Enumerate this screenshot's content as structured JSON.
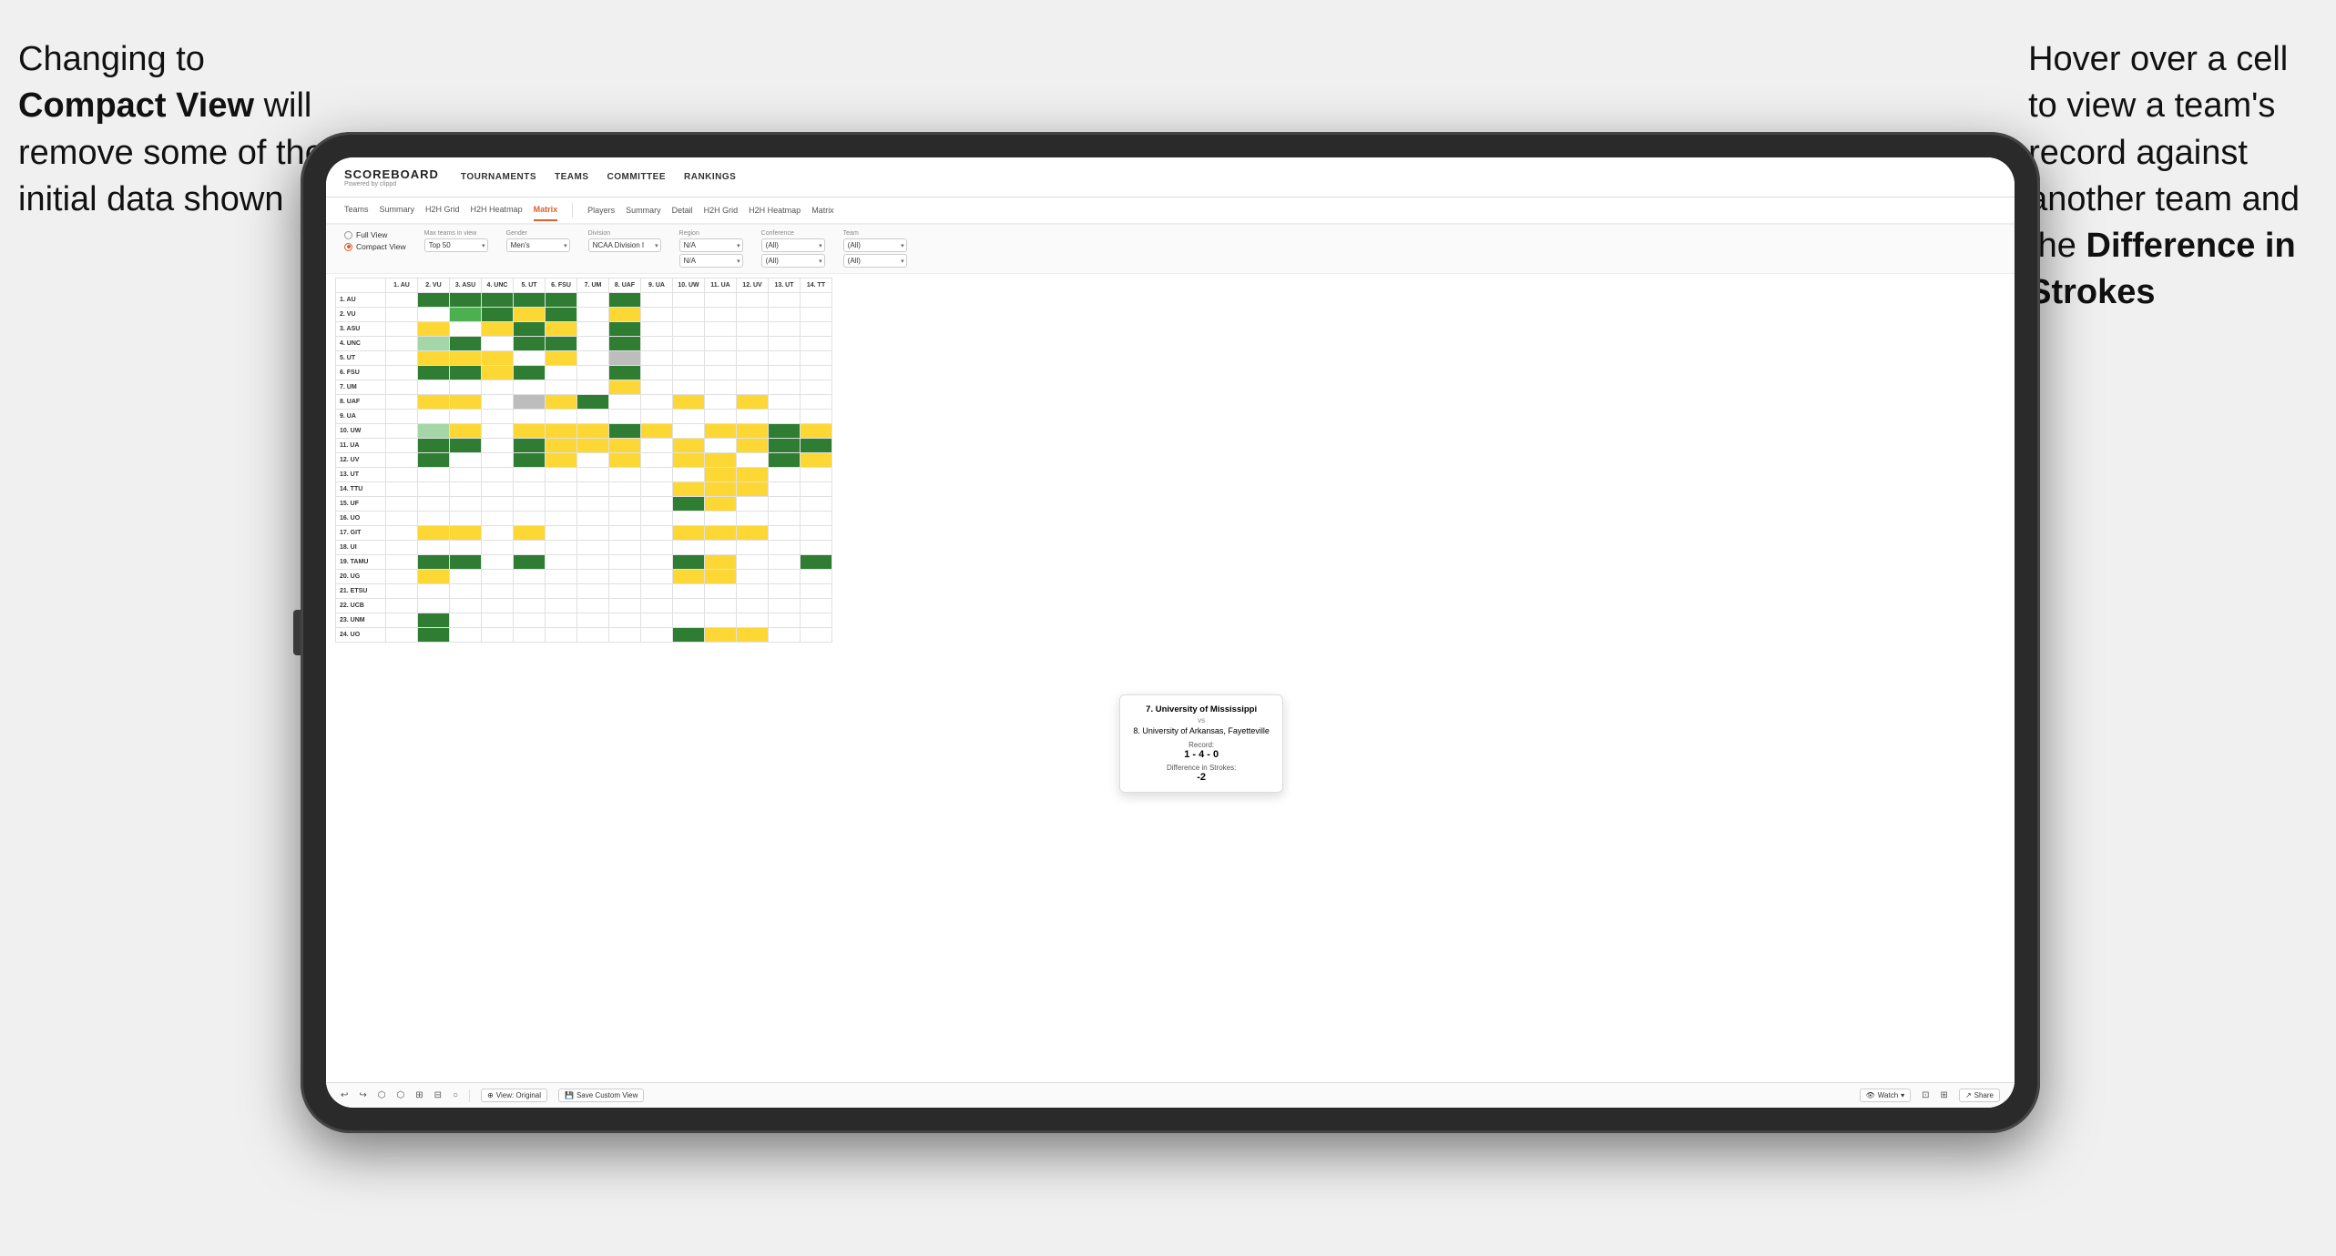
{
  "annotations": {
    "left": {
      "line1": "Changing to",
      "line2_bold": "Compact View",
      "line2_rest": " will",
      "line3": "remove some of the",
      "line4": "initial data shown"
    },
    "right": {
      "line1": "Hover over a cell",
      "line2": "to view a team's",
      "line3": "record against",
      "line4": "another team and",
      "line5_pre": "the ",
      "line5_bold": "Difference in",
      "line6_bold": "Strokes"
    }
  },
  "nav": {
    "logo": "SCOREBOARD",
    "logo_sub": "Powered by clippd",
    "links": [
      "TOURNAMENTS",
      "TEAMS",
      "COMMITTEE",
      "RANKINGS"
    ]
  },
  "sub_nav": {
    "group1": [
      "Teams",
      "Summary",
      "H2H Grid",
      "H2H Heatmap",
      "Matrix"
    ],
    "group2": [
      "Players",
      "Summary",
      "Detail",
      "H2H Grid",
      "H2H Heatmap",
      "Matrix"
    ],
    "active": "Matrix"
  },
  "controls": {
    "view_options": [
      "Full View",
      "Compact View"
    ],
    "view_selected": "Compact View",
    "max_teams_label": "Max teams in view",
    "max_teams_value": "Top 50",
    "gender_label": "Gender",
    "gender_value": "Men's",
    "division_label": "Division",
    "division_value": "NCAA Division I",
    "region_label": "Region",
    "region_value1": "N/A",
    "region_value2": "N/A",
    "conference_label": "Conference",
    "conference_value1": "(All)",
    "conference_value2": "(All)",
    "team_label": "Team",
    "team_value1": "(All)",
    "team_value2": "(All)"
  },
  "matrix": {
    "col_headers": [
      "",
      "1. AU",
      "2. VU",
      "3. ASU",
      "4. UNC",
      "5. UT",
      "6. FSU",
      "7. UM",
      "8. UAF",
      "9. UA",
      "10. UW",
      "11. UA",
      "12. UV",
      "13. UT",
      "14. TT"
    ],
    "rows": [
      {
        "label": "1. AU",
        "cells": [
          "diag",
          "green_dark",
          "green_dark",
          "green_dark",
          "green_dark",
          "green_dark",
          "white",
          "green_dark",
          "white",
          "white",
          "white",
          "white",
          "white",
          "white"
        ]
      },
      {
        "label": "2. VU",
        "cells": [
          "white",
          "diag",
          "green_med",
          "green_dark",
          "yellow",
          "green_dark",
          "white",
          "yellow",
          "white",
          "white",
          "white",
          "white",
          "white",
          "white"
        ]
      },
      {
        "label": "3. ASU",
        "cells": [
          "white",
          "yellow",
          "diag",
          "yellow",
          "green_dark",
          "yellow",
          "white",
          "green_dark",
          "white",
          "white",
          "white",
          "white",
          "white",
          "white"
        ]
      },
      {
        "label": "4. UNC",
        "cells": [
          "white",
          "green_light",
          "green_dark",
          "diag",
          "green_dark",
          "green_dark",
          "white",
          "green_dark",
          "white",
          "white",
          "white",
          "white",
          "white",
          "white"
        ]
      },
      {
        "label": "5. UT",
        "cells": [
          "white",
          "yellow",
          "yellow",
          "yellow",
          "diag",
          "yellow",
          "white",
          "gray",
          "white",
          "white",
          "white",
          "white",
          "white",
          "white"
        ]
      },
      {
        "label": "6. FSU",
        "cells": [
          "white",
          "green_dark",
          "green_dark",
          "yellow",
          "green_dark",
          "diag",
          "white",
          "green_dark",
          "white",
          "white",
          "white",
          "white",
          "white",
          "white"
        ]
      },
      {
        "label": "7. UM",
        "cells": [
          "white",
          "white",
          "white",
          "white",
          "white",
          "white",
          "diag",
          "yellow",
          "white",
          "white",
          "white",
          "white",
          "white",
          "white"
        ]
      },
      {
        "label": "8. UAF",
        "cells": [
          "white",
          "yellow",
          "yellow",
          "white",
          "gray",
          "yellow",
          "green_dark",
          "diag",
          "white",
          "yellow",
          "white",
          "yellow",
          "white",
          "white"
        ]
      },
      {
        "label": "9. UA",
        "cells": [
          "white",
          "white",
          "white",
          "white",
          "white",
          "white",
          "white",
          "white",
          "diag",
          "white",
          "white",
          "white",
          "white",
          "white"
        ]
      },
      {
        "label": "10. UW",
        "cells": [
          "white",
          "green_light",
          "yellow",
          "white",
          "yellow",
          "yellow",
          "yellow",
          "green_dark",
          "yellow",
          "diag",
          "yellow",
          "yellow",
          "green_dark",
          "yellow"
        ]
      },
      {
        "label": "11. UA",
        "cells": [
          "white",
          "green_dark",
          "green_dark",
          "white",
          "green_dark",
          "yellow",
          "yellow",
          "yellow",
          "white",
          "yellow",
          "diag",
          "yellow",
          "green_dark",
          "green_dark"
        ]
      },
      {
        "label": "12. UV",
        "cells": [
          "white",
          "green_dark",
          "white",
          "white",
          "green_dark",
          "yellow",
          "white",
          "yellow",
          "white",
          "yellow",
          "yellow",
          "diag",
          "green_dark",
          "yellow"
        ]
      },
      {
        "label": "13. UT",
        "cells": [
          "white",
          "white",
          "white",
          "white",
          "white",
          "white",
          "white",
          "white",
          "white",
          "white",
          "yellow",
          "yellow",
          "diag",
          "white"
        ]
      },
      {
        "label": "14. TTU",
        "cells": [
          "white",
          "white",
          "white",
          "white",
          "white",
          "white",
          "white",
          "white",
          "white",
          "yellow",
          "yellow",
          "yellow",
          "white",
          "diag"
        ]
      },
      {
        "label": "15. UF",
        "cells": [
          "white",
          "white",
          "white",
          "white",
          "white",
          "white",
          "white",
          "white",
          "white",
          "green_dark",
          "yellow",
          "white",
          "white",
          "white"
        ]
      },
      {
        "label": "16. UO",
        "cells": [
          "white",
          "white",
          "white",
          "white",
          "white",
          "white",
          "white",
          "white",
          "white",
          "white",
          "white",
          "white",
          "white",
          "white"
        ]
      },
      {
        "label": "17. GIT",
        "cells": [
          "white",
          "yellow",
          "yellow",
          "white",
          "yellow",
          "white",
          "white",
          "white",
          "white",
          "yellow",
          "yellow",
          "yellow",
          "white",
          "white"
        ]
      },
      {
        "label": "18. UI",
        "cells": [
          "white",
          "white",
          "white",
          "white",
          "white",
          "white",
          "white",
          "white",
          "white",
          "white",
          "white",
          "white",
          "white",
          "white"
        ]
      },
      {
        "label": "19. TAMU",
        "cells": [
          "white",
          "green_dark",
          "green_dark",
          "white",
          "green_dark",
          "white",
          "white",
          "white",
          "white",
          "green_dark",
          "yellow",
          "white",
          "white",
          "green_dark"
        ]
      },
      {
        "label": "20. UG",
        "cells": [
          "white",
          "yellow",
          "white",
          "white",
          "white",
          "white",
          "white",
          "white",
          "white",
          "yellow",
          "yellow",
          "white",
          "white",
          "white"
        ]
      },
      {
        "label": "21. ETSU",
        "cells": [
          "white",
          "white",
          "white",
          "white",
          "white",
          "white",
          "white",
          "white",
          "white",
          "white",
          "white",
          "white",
          "white",
          "white"
        ]
      },
      {
        "label": "22. UCB",
        "cells": [
          "white",
          "white",
          "white",
          "white",
          "white",
          "white",
          "white",
          "white",
          "white",
          "white",
          "white",
          "white",
          "white",
          "white"
        ]
      },
      {
        "label": "23. UNM",
        "cells": [
          "white",
          "green_dark",
          "white",
          "white",
          "white",
          "white",
          "white",
          "white",
          "white",
          "white",
          "white",
          "white",
          "white",
          "white"
        ]
      },
      {
        "label": "24. UO",
        "cells": [
          "white",
          "green_dark",
          "white",
          "white",
          "white",
          "white",
          "white",
          "white",
          "white",
          "green_dark",
          "yellow",
          "yellow",
          "white",
          "white"
        ]
      }
    ]
  },
  "tooltip": {
    "team1": "7. University of Mississippi",
    "vs": "vs",
    "team2": "8. University of Arkansas, Fayetteville",
    "record_label": "Record:",
    "record_value": "1 - 4 - 0",
    "strokes_label": "Difference in Strokes:",
    "strokes_value": "-2"
  },
  "toolbar": {
    "icons": [
      "↩",
      "↪",
      "⬡",
      "⬡",
      "⬡+",
      "⬡-",
      "○"
    ],
    "view_original": "View: Original",
    "save_custom": "Save Custom View",
    "watch": "Watch",
    "share": "Share"
  }
}
